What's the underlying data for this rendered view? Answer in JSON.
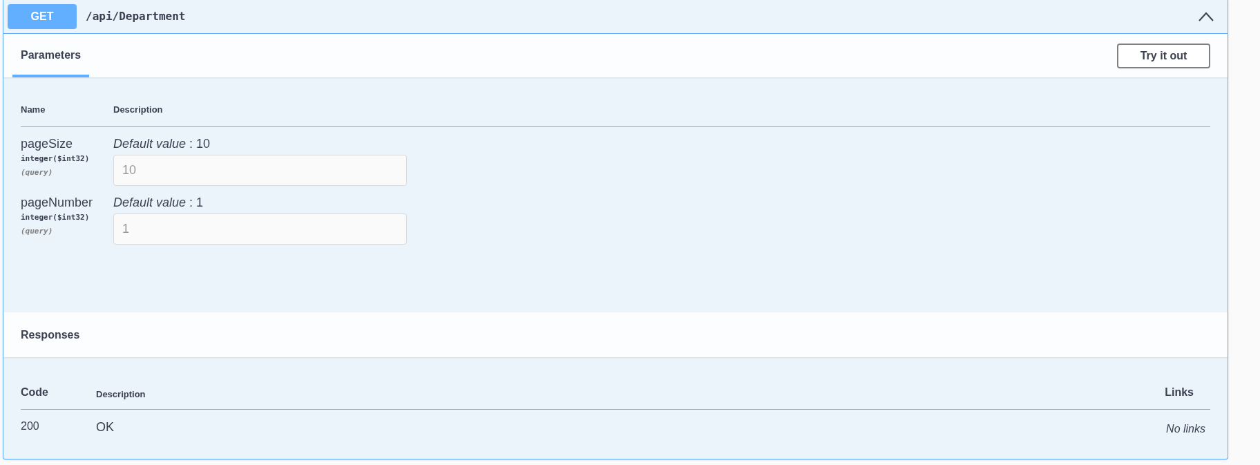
{
  "operation": {
    "method": "GET",
    "path": "/api/Department",
    "expanded": true
  },
  "tabs": [
    {
      "label": "Parameters",
      "selected": true
    }
  ],
  "try_button": "Try it out",
  "parameters_table": {
    "columns": [
      "Name",
      "Description"
    ],
    "rows": [
      {
        "name": "pageSize",
        "type": "integer($int32)",
        "location": "(query)",
        "default": "*Default value* : 10",
        "placeholder": "10"
      },
      {
        "name": "pageNumber",
        "type": "integer($int32)",
        "location": "(query)",
        "default": "*Default value* : 1",
        "placeholder": "1"
      }
    ]
  },
  "responses": {
    "title": "Responses",
    "columns": [
      "Code",
      "Description",
      "Links"
    ],
    "rows": [
      {
        "code": "200",
        "description": "OK",
        "links": "No links"
      }
    ]
  }
}
